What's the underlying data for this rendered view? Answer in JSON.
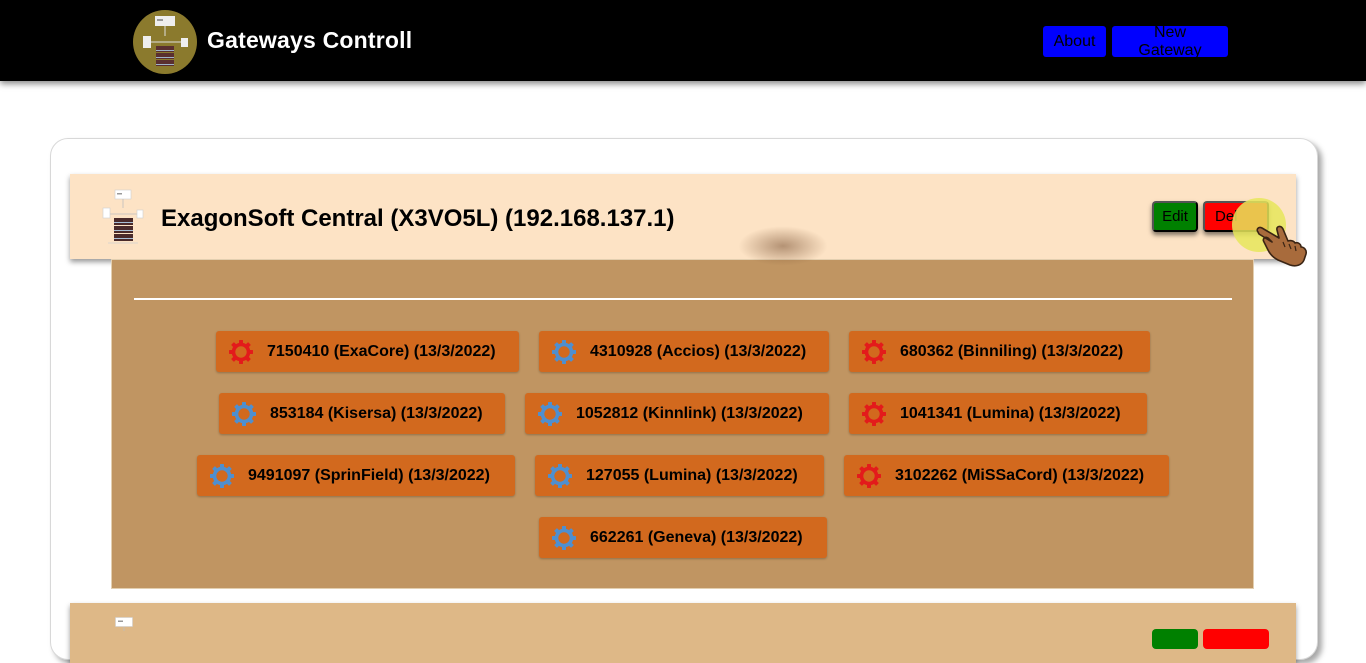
{
  "header": {
    "title": "Gateways Controll",
    "nav": {
      "about": "About",
      "new_gateway": "New Gateway"
    }
  },
  "gateways": [
    {
      "title": "ExagonSoft Central (X3VO5L) (192.168.137.1)",
      "edit_label": "Edit",
      "delete_label": "Del",
      "devices": [
        {
          "label": "7150410 (ExaCore) (13/3/2022)",
          "status": "offline"
        },
        {
          "label": "4310928 (Accios) (13/3/2022)",
          "status": "online"
        },
        {
          "label": "680362 (Binniling) (13/3/2022)",
          "status": "offline"
        },
        {
          "label": "853184 (Kisersa) (13/3/2022)",
          "status": "online"
        },
        {
          "label": "1052812 (Kinnlink) (13/3/2022)",
          "status": "online"
        },
        {
          "label": "1041341 (Lumina) (13/3/2022)",
          "status": "offline"
        },
        {
          "label": "9491097 (SprinField) (13/3/2022)",
          "status": "online"
        },
        {
          "label": "127055 (Lumina) (13/3/2022)",
          "status": "online"
        },
        {
          "label": "3102262 (MiSSaCord) (13/3/2022)",
          "status": "offline"
        },
        {
          "label": "662261 (Geneva) (13/3/2022)",
          "status": "online"
        }
      ]
    }
  ],
  "colors": {
    "online_gear": "#4f8fcf",
    "offline_gear": "#e31b1b",
    "device_bg": "#d2691e",
    "panel_bg": "#c09562",
    "header_bg": "#fde3c5"
  }
}
